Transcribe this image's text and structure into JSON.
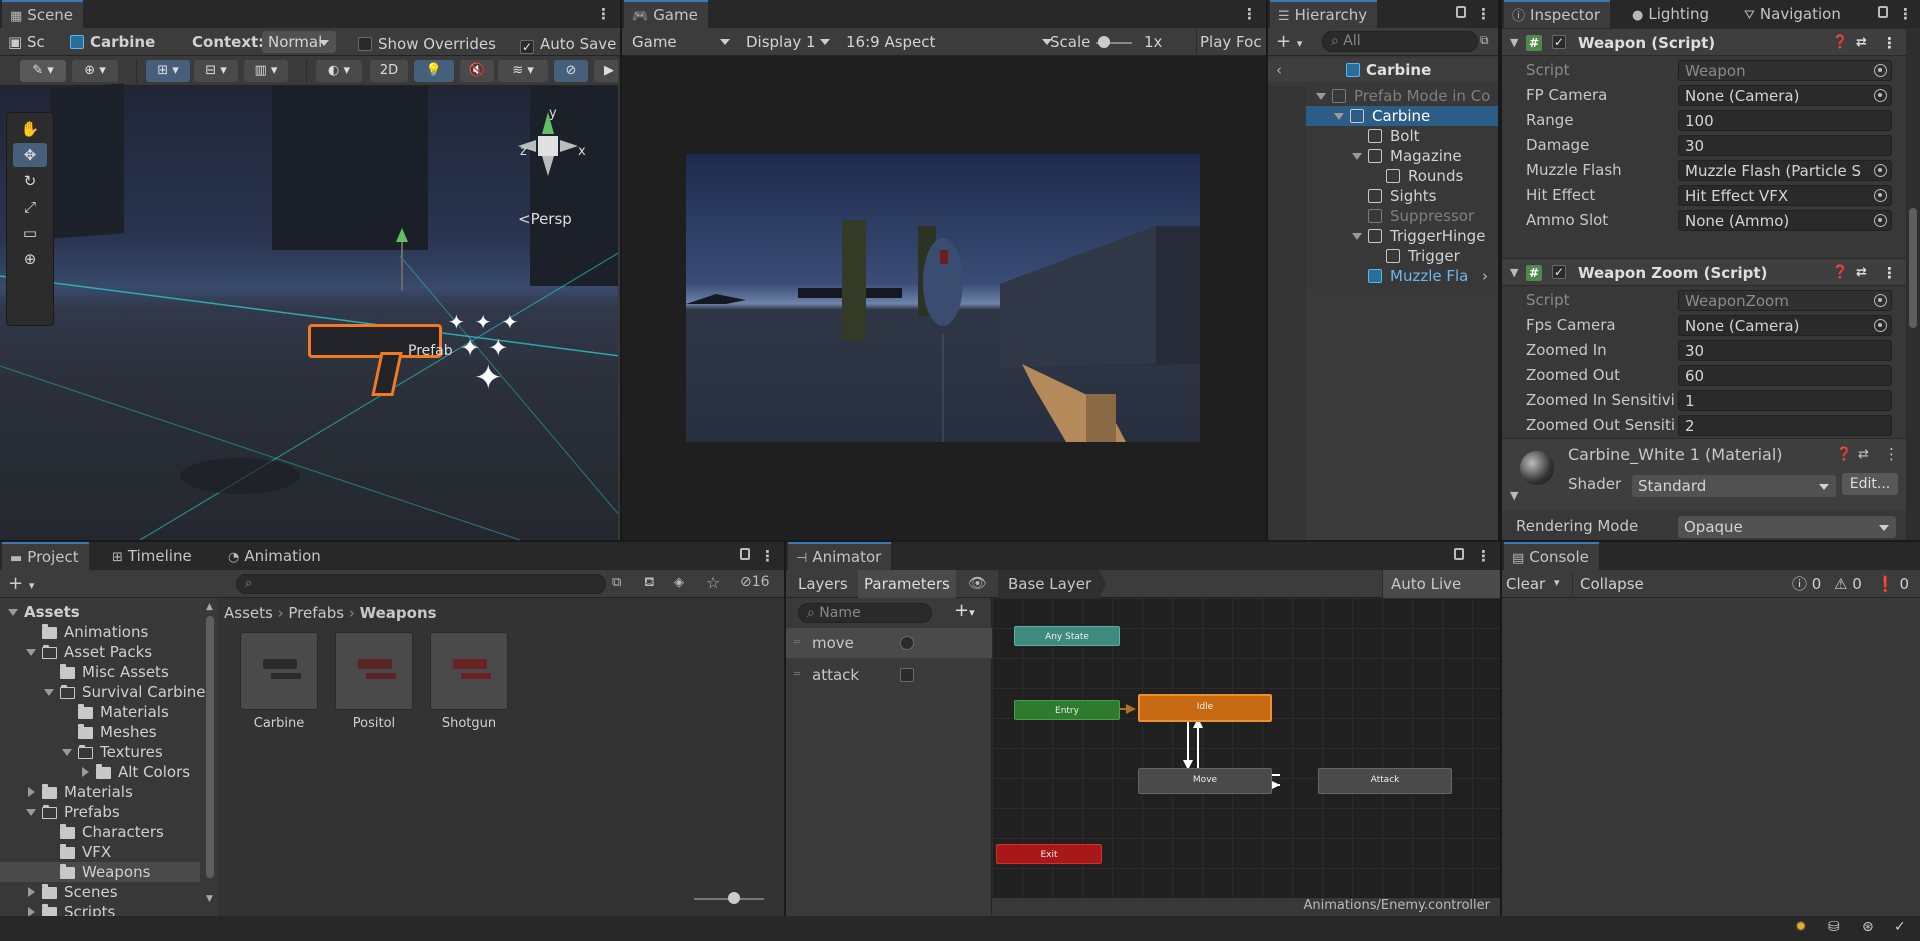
{
  "scene": {
    "tab": "Scene",
    "breadcrumb_short": "Sc",
    "breadcrumb_item": "Carbine",
    "context_label": "Context:",
    "context_value": "Normal",
    "show_overrides": "Show Overrides",
    "auto_save": "Auto Save",
    "btn_2d": "2D",
    "persp": "<Persp",
    "prefab_label": "Prefab",
    "gizmo_axes": {
      "x": "x",
      "y": "y",
      "z": "z"
    }
  },
  "game": {
    "tab": "Game",
    "mode": "Game",
    "display": "Display 1",
    "aspect": "16:9 Aspect",
    "scale_label": "Scale",
    "scale_value": "1x",
    "play_focused": "Play Foc"
  },
  "hierarchy": {
    "tab": "Hierarchy",
    "search_placeholder": "All",
    "root": "Carbine",
    "items": [
      {
        "label": "Prefab Mode in Co",
        "indent": 0,
        "expand": "down",
        "style": "dim"
      },
      {
        "label": "Carbine",
        "indent": 1,
        "expand": "down",
        "style": "selected"
      },
      {
        "label": "Bolt",
        "indent": 2,
        "expand": "",
        "style": "normal"
      },
      {
        "label": "Magazine",
        "indent": 2,
        "expand": "down",
        "style": "normal"
      },
      {
        "label": "Rounds",
        "indent": 3,
        "expand": "",
        "style": "normal"
      },
      {
        "label": "Sights",
        "indent": 2,
        "expand": "",
        "style": "normal"
      },
      {
        "label": "Suppressor",
        "indent": 2,
        "expand": "",
        "style": "dim"
      },
      {
        "label": "TriggerHinge",
        "indent": 2,
        "expand": "down",
        "style": "normal"
      },
      {
        "label": "Trigger",
        "indent": 3,
        "expand": "",
        "style": "normal"
      },
      {
        "label": "Muzzle Fla",
        "indent": 2,
        "expand": "right",
        "style": "prefab"
      }
    ]
  },
  "inspector": {
    "tabs": [
      "Inspector",
      "Lighting",
      "Navigation"
    ],
    "weapon": {
      "title": "Weapon (Script)",
      "rows": [
        {
          "label": "Script",
          "value": "Weapon"
        },
        {
          "label": "FP Camera",
          "value": "None (Camera)"
        },
        {
          "label": "Range",
          "value": "100"
        },
        {
          "label": "Damage",
          "value": "30"
        },
        {
          "label": "Muzzle Flash",
          "value": "Muzzle Flash (Particle S"
        },
        {
          "label": "Hit Effect",
          "value": "Hit Effect VFX"
        },
        {
          "label": "Ammo Slot",
          "value": "None (Ammo)"
        }
      ]
    },
    "zoom": {
      "title": "Weapon Zoom (Script)",
      "rows": [
        {
          "label": "Script",
          "value": "WeaponZoom"
        },
        {
          "label": "Fps Camera",
          "value": "None (Camera)"
        },
        {
          "label": "Zoomed In",
          "value": "30"
        },
        {
          "label": "Zoomed Out",
          "value": "60"
        },
        {
          "label": "Zoomed In Sensitivit",
          "value": "1"
        },
        {
          "label": "Zoomed Out Sensitiv",
          "value": "2"
        }
      ]
    },
    "material": {
      "title": "Carbine_White 1 (Material)",
      "shader_label": "Shader",
      "shader_value": "Standard",
      "edit": "Edit...",
      "rendering_mode_label": "Rendering Mode",
      "rendering_mode_value": "Opaque"
    }
  },
  "project": {
    "tabs": [
      "Project",
      "Timeline",
      "Animation"
    ],
    "hidden_count": "16",
    "breadcrumb": [
      "Assets",
      "Prefabs",
      "Weapons"
    ],
    "tree": [
      {
        "label": "Assets",
        "indent": 0,
        "expand": "down",
        "bold": true
      },
      {
        "label": "Animations",
        "indent": 1,
        "expand": ""
      },
      {
        "label": "Asset Packs",
        "indent": 1,
        "expand": "down"
      },
      {
        "label": "Misc Assets",
        "indent": 2,
        "expand": ""
      },
      {
        "label": "Survival Carbine",
        "indent": 2,
        "expand": "down"
      },
      {
        "label": "Materials",
        "indent": 3,
        "expand": ""
      },
      {
        "label": "Meshes",
        "indent": 3,
        "expand": ""
      },
      {
        "label": "Textures",
        "indent": 3,
        "expand": "down"
      },
      {
        "label": "Alt Colors",
        "indent": 4,
        "expand": "right"
      },
      {
        "label": "Materials",
        "indent": 1,
        "expand": "right"
      },
      {
        "label": "Prefabs",
        "indent": 1,
        "expand": "down"
      },
      {
        "label": "Characters",
        "indent": 2,
        "expand": ""
      },
      {
        "label": "VFX",
        "indent": 2,
        "expand": ""
      },
      {
        "label": "Weapons",
        "indent": 2,
        "expand": "",
        "selected": true
      },
      {
        "label": "Scenes",
        "indent": 1,
        "expand": "right"
      },
      {
        "label": "Scripts",
        "indent": 1,
        "expand": "right"
      }
    ],
    "assets": [
      {
        "label": "Carbine",
        "color": "#2b2b2b"
      },
      {
        "label": "Positol",
        "color": "#5a2424"
      },
      {
        "label": "Shotgun",
        "color": "#6a2222"
      }
    ]
  },
  "animator": {
    "tab": "Animator",
    "layers": "Layers",
    "parameters": "Parameters",
    "base_layer": "Base Layer",
    "auto_live_link": "Auto Live Link",
    "search_placeholder": "Name",
    "params": [
      {
        "name": "move",
        "type": "bool-circle"
      },
      {
        "name": "attack",
        "type": "trigger-square"
      }
    ],
    "states": {
      "any": "Any State",
      "entry": "Entry",
      "idle": "Idle",
      "move": "Move",
      "attack": "Attack",
      "exit": "Exit"
    },
    "footer_path": "Animations/Enemy.controller"
  },
  "console": {
    "tab": "Console",
    "clear": "Clear",
    "collapse": "Collapse",
    "counts": {
      "info": "0",
      "warn": "0",
      "error": "0"
    }
  }
}
